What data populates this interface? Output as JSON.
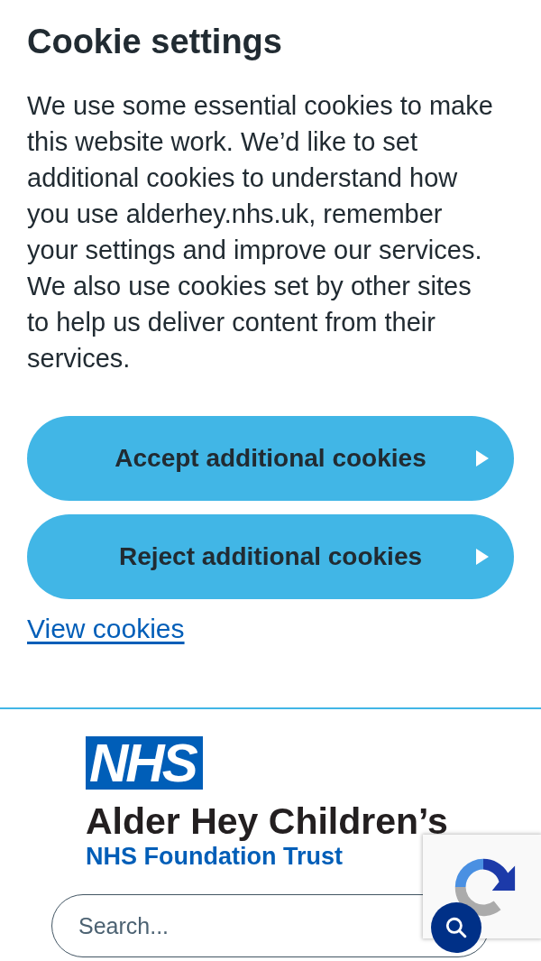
{
  "cookie_banner": {
    "title": "Cookie settings",
    "description": "We use some essential cookies to make this website work. We’d like to set additional cookies to understand how you use alderhey.nhs.uk, remember your settings and improve our services. We also use cookies set by other sites to help us deliver content from their services.",
    "buttons": [
      {
        "label": "Accept additional cookies"
      },
      {
        "label": "Reject additional cookies"
      }
    ],
    "link": "View cookies"
  },
  "header": {
    "logo": "NHS",
    "name": "Alder Hey Children’s",
    "subtitle": "NHS Foundation Trust",
    "search": {
      "placeholder": "Search..."
    }
  }
}
